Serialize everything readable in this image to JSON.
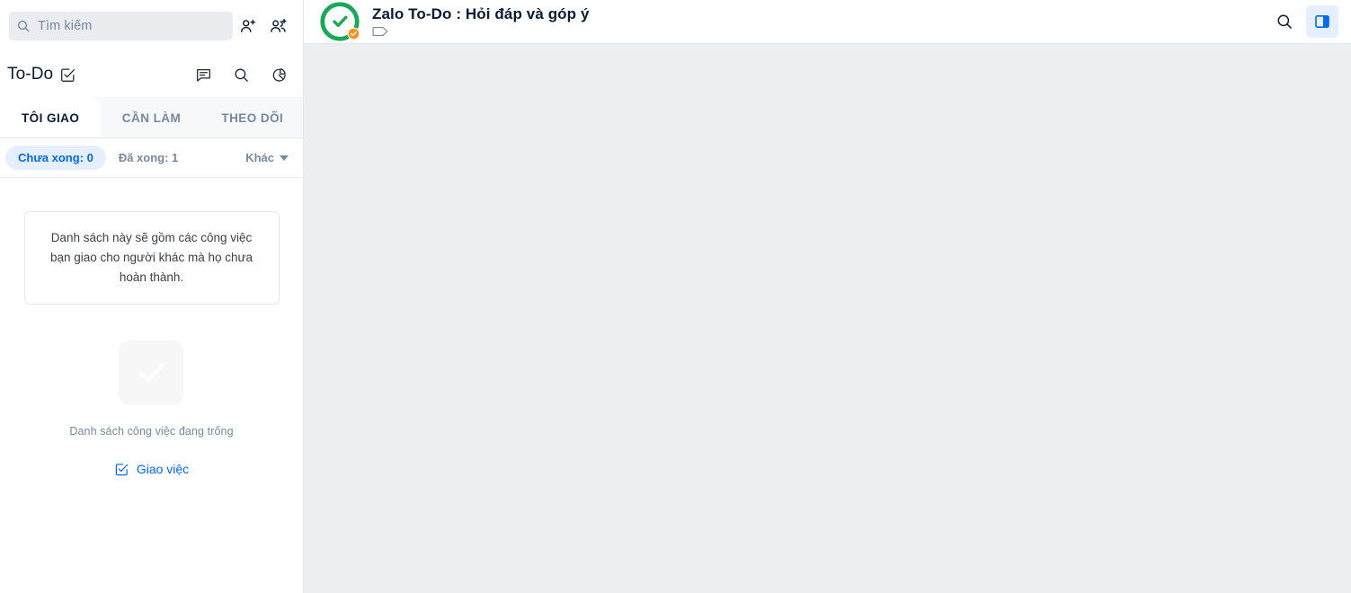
{
  "sidebar": {
    "search": {
      "placeholder": "Tìm kiếm",
      "icon": "search-icon"
    },
    "header_icons": [
      {
        "name": "add-friend-icon",
        "title": "Thêm bạn"
      },
      {
        "name": "add-group-icon",
        "title": "Tạo nhóm chat"
      }
    ],
    "todo": {
      "title": "To-Do",
      "title_icon": "todo-checkbox-edit-icon",
      "actions": [
        {
          "name": "message-icon"
        },
        {
          "name": "search-icon"
        },
        {
          "name": "chart-pie-icon"
        }
      ]
    },
    "tabs": [
      {
        "label": "TÔI GIAO",
        "active": true
      },
      {
        "label": "CẦN LÀM",
        "active": false
      },
      {
        "label": "THEO DÕI",
        "active": false
      }
    ],
    "filters": [
      {
        "label": "Chưa xong: 0",
        "active": true
      },
      {
        "label": "Đã xong: 1",
        "active": false
      }
    ],
    "more_filter": {
      "label": "Khác",
      "icon": "chevron-down-icon"
    },
    "notice_text": "Danh sách này sẽ gồm các công việc bạn giao cho người khác mà họ chưa hoàn thành.",
    "empty_state": {
      "icon": "check-icon",
      "label": "Danh sách công việc đang trống",
      "action_label": "Giao việc",
      "action_icon": "todo-checkbox-edit-icon"
    }
  },
  "conversation": {
    "avatar": {
      "name": "zalo-todo-avatar",
      "icon": "check-circle-icon",
      "badge_icon": "verified-badge-icon"
    },
    "title": "Zalo To-Do : Hỏi đáp và góp ý",
    "subtitle_icon": "tag-icon",
    "actions": [
      {
        "name": "search-icon",
        "active": false
      },
      {
        "name": "info-panel-icon",
        "active": true
      }
    ]
  },
  "colors": {
    "accent_blue": "#0068ff",
    "chip_bg": "#e5efff",
    "muted_text": "#7589a3",
    "dark_text": "#081c36",
    "avatar_green": "#18a957",
    "badge_orange": "#f6921e",
    "content_bg": "#eceff1",
    "search_bg": "#ebecf0"
  }
}
